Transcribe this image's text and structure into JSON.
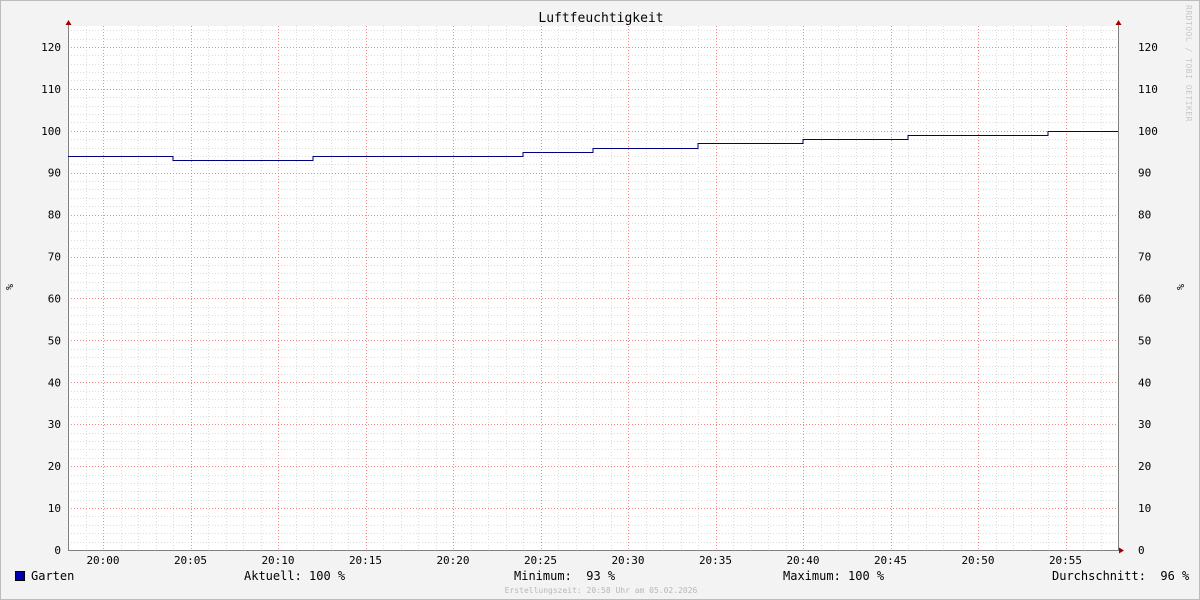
{
  "chart_data": {
    "type": "line",
    "title": "Luftfeuchtigkeit",
    "ylabel": "%",
    "ylim": [
      0,
      125
    ],
    "ytick_labels": [
      "0",
      "10",
      "20",
      "30",
      "40",
      "50",
      "60",
      "70",
      "80",
      "90",
      "100",
      "110",
      "120"
    ],
    "xtick_labels": [
      "20:00",
      "20:05",
      "20:10",
      "20:15",
      "20:20",
      "20:25",
      "20:30",
      "20:35",
      "20:40",
      "20:45",
      "20:50",
      "20:55"
    ],
    "xrange": [
      "19:58",
      "20:58"
    ],
    "grid": true,
    "series": [
      {
        "name": "Garten",
        "color": "#000080",
        "points": [
          [
            "19:58",
            94
          ],
          [
            "20:04",
            93
          ],
          [
            "20:12",
            94
          ],
          [
            "20:24",
            95
          ],
          [
            "20:28",
            96
          ],
          [
            "20:34",
            97
          ],
          [
            "20:40",
            98
          ],
          [
            "20:46",
            99
          ],
          [
            "20:54",
            100
          ],
          [
            "20:58",
            100
          ]
        ]
      }
    ],
    "watermark": "RRDTOOL / TOBI OETIKER"
  },
  "legend": {
    "series_name": "Garten",
    "swatch_color": "#0000aa",
    "aktuell": "Aktuell: 100 %",
    "minimum": "Minimum:  93 %",
    "maximum": "Maximum: 100 %",
    "durchschnitt": "Durchschnitt:  96 %"
  },
  "footer": "Erstellungszeit: 20:58 Uhr am 05.02.2026"
}
